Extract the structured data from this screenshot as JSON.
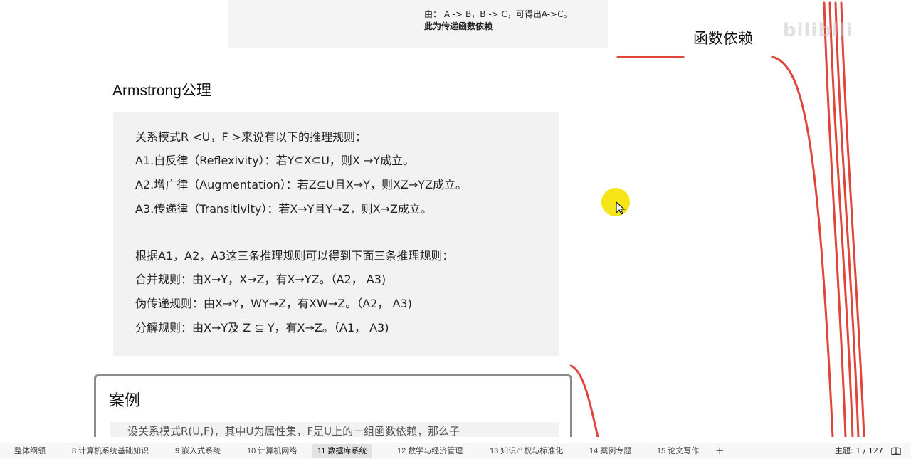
{
  "document": {
    "top_box": {
      "line1": "由： A -> B，B -> C，可得出A->C。",
      "line2": "此为传递函数依赖"
    },
    "section_title": "Armstrong公理",
    "rules": [
      "关系模式R <U，F >来说有以下的推理规则：",
      "A1.自反律（Reflexivity）：若Y⊆X⊆U，则X →Y成立。",
      "A2.增广律（Augmentation）：若Z⊆U且X→Y，则XZ→YZ成立。",
      "A3.传递律（Transitivity）：若X→Y且Y→Z，则X→Z成立。",
      "根据A1，A2，A3这三条推理规则可以得到下面三条推理规则：",
      "合并规则：由X→Y，X→Z，有X→YZ。（A2， A3)",
      "伪传递规则：由X→Y，WY→Z，有XW→Z。（A2， A3)",
      "分解规则：由X→Y及 Z ⊆ Y，有X→Z。（A1， A3)"
    ],
    "case_title": "案例",
    "case_text": "设关系模式R(U,F)，其中U为属性集，F是U上的一组函数依赖，那么子"
  },
  "mindmap": {
    "node_label": "函数依赖",
    "line_color": "#e0453c"
  },
  "watermark": "bilibili",
  "status_bar": {
    "tabs": [
      {
        "label": "整体纲领",
        "active": false
      },
      {
        "label": "8 计算机系统基础知识",
        "active": false
      },
      {
        "label": "9 嵌入式系统",
        "active": false
      },
      {
        "label": "10 计算机网络",
        "active": false
      },
      {
        "label": "11 数据库系统",
        "active": true
      },
      {
        "label": "12 数学与经济管理",
        "active": false
      },
      {
        "label": "13 知识产权与标准化",
        "active": false
      },
      {
        "label": "14 案例专题",
        "active": false
      },
      {
        "label": "15 论文写作",
        "active": false
      }
    ],
    "add_label": "+",
    "theme_info": "主题: 1 / 127"
  },
  "colors": {
    "highlight": "#f4e40a",
    "box_bg": "#f2f2f2",
    "accent_line": "#e0453c"
  }
}
